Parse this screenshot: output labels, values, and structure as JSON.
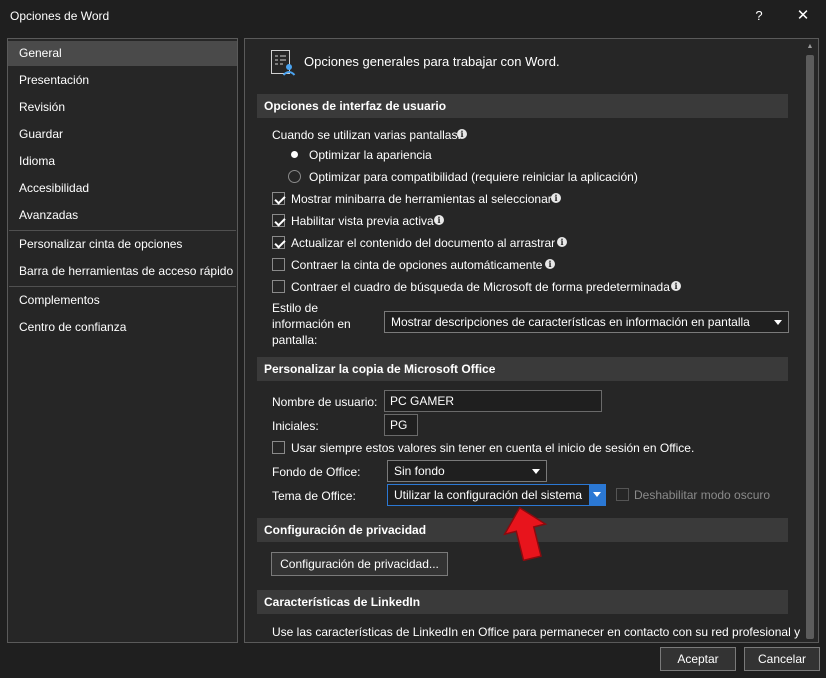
{
  "window": {
    "title": "Opciones de Word",
    "help_label": "?",
    "close_label": "✕"
  },
  "sidebar": {
    "items": [
      {
        "label": "General",
        "selected": true
      },
      {
        "label": "Presentación"
      },
      {
        "label": "Revisión"
      },
      {
        "label": "Guardar"
      },
      {
        "label": "Idioma"
      },
      {
        "label": "Accesibilidad"
      },
      {
        "label": "Avanzadas"
      },
      {
        "label": "Personalizar cinta de opciones"
      },
      {
        "label": "Barra de herramientas de acceso rápido"
      },
      {
        "label": "Complementos"
      },
      {
        "label": "Centro de confianza"
      }
    ]
  },
  "main": {
    "heading": "Opciones generales para trabajar con Word.",
    "ui_section": {
      "title": "Opciones de interfaz de usuario",
      "multi_screen_label": "Cuando se utilizan varias pantallas:",
      "radio_optimize_appearance": "Optimizar la apariencia",
      "radio_optimize_compat": "Optimizar para compatibilidad (requiere reiniciar la aplicación)",
      "cb_minibar": "Mostrar minibarra de herramientas al seleccionar",
      "cb_live_preview": "Habilitar vista previa activa",
      "cb_update_drag": "Actualizar el contenido del documento al arrastrar",
      "cb_collapse_ribbon": "Contraer la cinta de opciones automáticamente",
      "cb_collapse_search": "Contraer el cuadro de búsqueda de Microsoft de forma predeterminada",
      "screentip_label_1": "Estilo de",
      "screentip_label_2": "información en",
      "screentip_label_3": "pantalla:",
      "screentip_value": "Mostrar descripciones de características en información en pantalla"
    },
    "personalize_section": {
      "title": "Personalizar la copia de Microsoft Office",
      "username_label": "Nombre de usuario:",
      "username_value": "PC GAMER",
      "initials_label": "Iniciales:",
      "initials_value": "PG",
      "cb_always_use": "Usar siempre estos valores sin tener en cuenta el inicio de sesión en Office.",
      "background_label": "Fondo de Office:",
      "background_value": "Sin fondo",
      "theme_label": "Tema de Office:",
      "theme_value": "Utilizar la configuración del sistema",
      "cb_disable_dark": "Deshabilitar modo oscuro"
    },
    "privacy_section": {
      "title": "Configuración de privacidad",
      "button_label": "Configuración de privacidad..."
    },
    "linkedin_section": {
      "title": "Características de LinkedIn",
      "description": "Use las características de LinkedIn en Office para permanecer en contacto con su red profesional y"
    }
  },
  "footer": {
    "accept_label": "Aceptar",
    "cancel_label": "Cancelar"
  },
  "colors": {
    "background": "#1f1f1f",
    "panel": "#262626",
    "section_header": "#3a3a3a",
    "focus_blue": "#2b78d4",
    "annotation_red": "#e8141c"
  }
}
